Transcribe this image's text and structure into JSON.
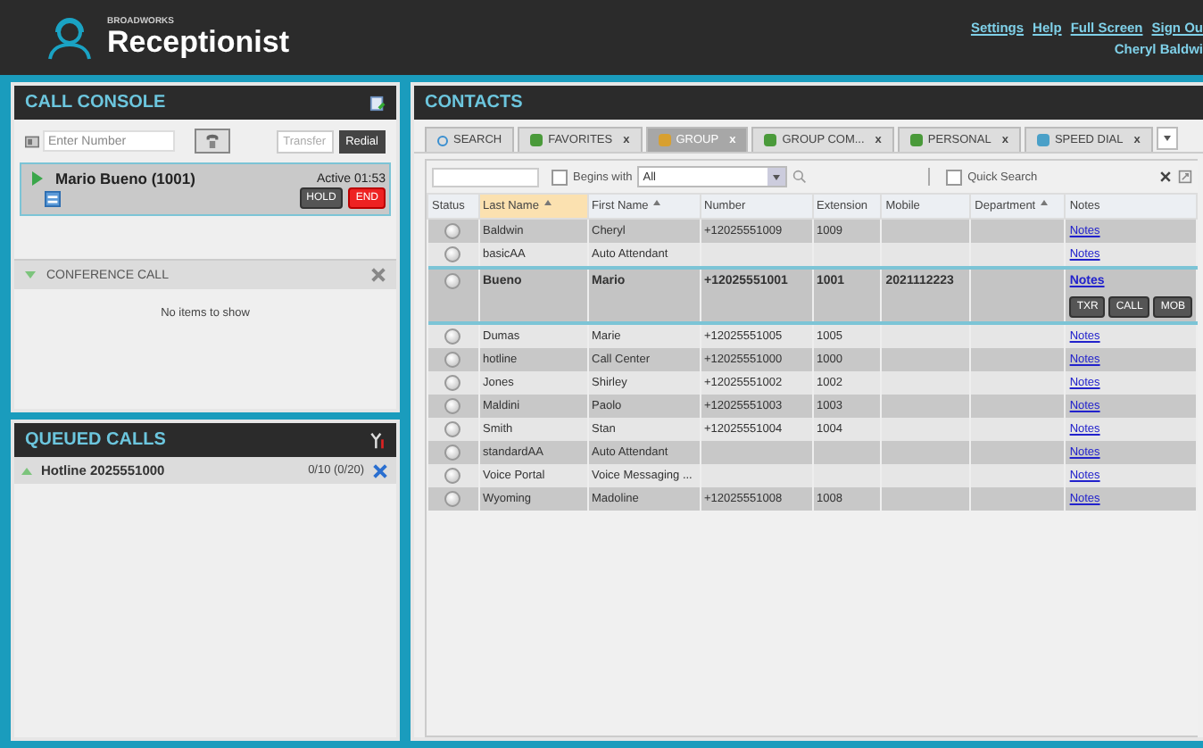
{
  "header": {
    "brand_small": "BROADWORKS",
    "brand": "Receptionist",
    "links": [
      "Settings",
      "Help",
      "Full Screen",
      "Sign Ou"
    ],
    "user": "Cheryl Baldwi"
  },
  "call_console": {
    "title": "CALL CONSOLE",
    "input": {
      "placeholder": "Enter Number"
    },
    "buttons": [
      {
        "label": "Transfer",
        "disabled": true
      },
      {
        "label": "Redial",
        "disabled": false
      }
    ],
    "call": {
      "name": "Mario Bueno (1001)",
      "status": "Active 01:53",
      "buttons": [
        {
          "label": "HOLD",
          "kind": "hold"
        },
        {
          "label": "END",
          "kind": "end"
        }
      ]
    },
    "conference": {
      "title": "CONFERENCE CALL",
      "expanded": true,
      "empty_text": "No items to show"
    }
  },
  "queued_calls": {
    "title": "QUEUED CALLS",
    "items": [
      {
        "name": "Hotline 2025551000",
        "count": "0/10 (0/20)",
        "expanded": false
      }
    ]
  },
  "contacts": {
    "title": "CONTACTS",
    "tabs": [
      {
        "label": "SEARCH",
        "selected": false
      },
      {
        "label": "FAVORITES",
        "close": "x",
        "selected": false
      },
      {
        "label": "GROUP",
        "close": "x",
        "selected": true
      },
      {
        "label": "GROUP COM...",
        "close": "x",
        "selected": false
      },
      {
        "label": "PERSONAL",
        "close": "x",
        "selected": false
      },
      {
        "label": "SPEED DIAL",
        "close": "x",
        "selected": false
      }
    ],
    "filter": {
      "begins_with": {
        "label": "Begins with",
        "checked": false
      },
      "select_value": "All",
      "quick_search": {
        "label": "Quick Search",
        "checked": false
      }
    },
    "columns": [
      {
        "label": "Status",
        "sortable": false,
        "sorted": false
      },
      {
        "label": "Last Name",
        "sortable": true,
        "sorted": true
      },
      {
        "label": "First Name",
        "sortable": true,
        "sorted": false
      },
      {
        "label": "Number",
        "sortable": false,
        "sorted": false
      },
      {
        "label": "Extension",
        "sortable": false,
        "sorted": false
      },
      {
        "label": "Mobile",
        "sortable": false,
        "sorted": false
      },
      {
        "label": "Department",
        "sortable": true,
        "sorted": false
      },
      {
        "label": "Notes",
        "sortable": false,
        "sorted": false
      }
    ],
    "rows": [
      {
        "cells": [
          "",
          "Baldwin",
          "Cheryl",
          "+12025551009",
          "1009",
          "",
          "",
          "Notes"
        ],
        "selected": false
      },
      {
        "cells": [
          "",
          "basicAA",
          "Auto Attendant",
          "",
          "",
          "",
          "",
          "Notes"
        ],
        "selected": false
      },
      {
        "cells": [
          "",
          "Bueno",
          "Mario",
          "+12025551001",
          "1001",
          "2021112223",
          "",
          "Notes"
        ],
        "selected": true,
        "actions": [
          "TXR",
          "CALL",
          "MOB"
        ]
      },
      {
        "cells": [
          "",
          "Dumas",
          "Marie",
          "+12025551005",
          "1005",
          "",
          "",
          "Notes"
        ],
        "selected": false
      },
      {
        "cells": [
          "",
          "hotline",
          "Call Center",
          "+12025551000",
          "1000",
          "",
          "",
          "Notes"
        ],
        "selected": false
      },
      {
        "cells": [
          "",
          "Jones",
          "Shirley",
          "+12025551002",
          "1002",
          "",
          "",
          "Notes"
        ],
        "selected": false
      },
      {
        "cells": [
          "",
          "Maldini",
          "Paolo",
          "+12025551003",
          "1003",
          "",
          "",
          "Notes"
        ],
        "selected": false
      },
      {
        "cells": [
          "",
          "Smith",
          "Stan",
          "+12025551004",
          "1004",
          "",
          "",
          "Notes"
        ],
        "selected": false
      },
      {
        "cells": [
          "",
          "standardAA",
          "Auto Attendant",
          "",
          "",
          "",
          "",
          "Notes"
        ],
        "selected": false
      },
      {
        "cells": [
          "",
          "Voice Portal",
          "Voice Messaging ...",
          "",
          "",
          "",
          "",
          "Notes"
        ],
        "selected": false
      },
      {
        "cells": [
          "",
          "Wyoming",
          "Madoline",
          "+12025551008",
          "1008",
          "",
          "",
          "Notes"
        ],
        "selected": false
      }
    ]
  }
}
